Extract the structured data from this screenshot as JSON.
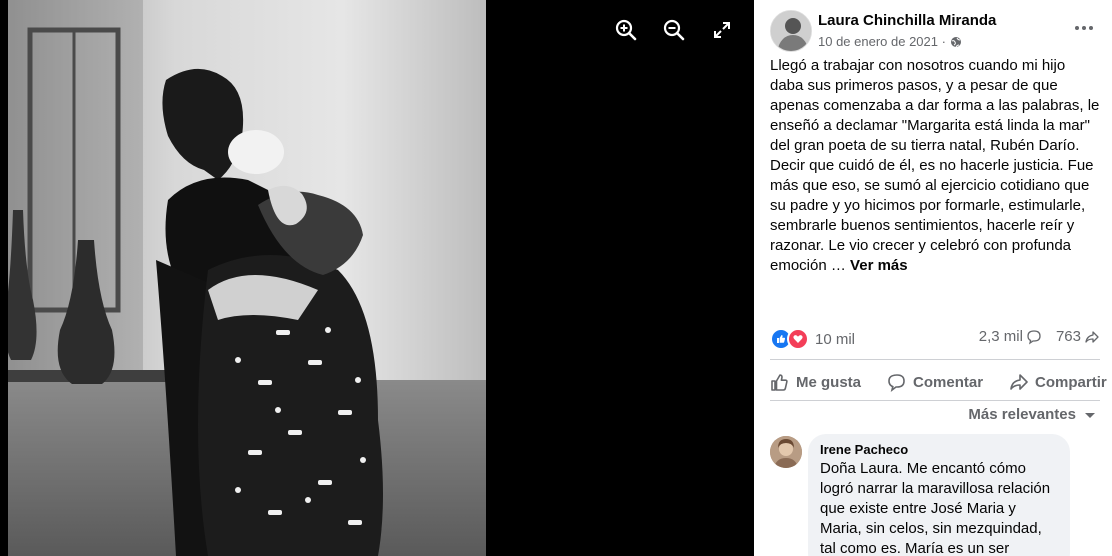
{
  "viewer": {
    "photo_alt": "Black and white photo of a young man in a face mask hugging an older woman",
    "controls": [
      {
        "name": "zoom-in-icon",
        "label": "Zoom in"
      },
      {
        "name": "zoom-out-icon",
        "label": "Zoom out"
      },
      {
        "name": "fullscreen-icon",
        "label": "Full screen"
      }
    ]
  },
  "post": {
    "author": "Laura Chinchilla Miranda",
    "date": "10 de enero de 2021 ·",
    "privacy_icon": "globe-icon",
    "text": "Llegó a trabajar con nosotros cuando mi hijo daba sus primeros pasos, y a pesar de que apenas comenzaba a dar forma a las palabras, le enseñó a declamar \"Margarita está linda la mar\" del gran poeta de su tierra natal, Rubén Darío. Decir que cuidó de él, es no hacerle justicia. Fue más que eso, se sumó al ejercicio cotidiano que su padre y yo hicimos por formarle, estimularle, sembrarle buenos sentimientos, hacerle reír y razonar. Le vio crecer y celebró con profunda emoción …",
    "see_more": "Ver más"
  },
  "stats": {
    "reactions_count": "10 mil",
    "comments_count": "2,3 mil",
    "shares_count": "763"
  },
  "actions": {
    "like": "Me gusta",
    "comment": "Comentar",
    "share": "Compartir"
  },
  "comments": {
    "sort_label": "Más relevantes",
    "items": [
      {
        "author": "Irene Pacheco",
        "text": "Doña Laura. Me encantó cómo logró narrar la maravillosa relación que existe entre José Maria y Maria, sin celos, sin mezquindad, tal como es. María es un ser"
      }
    ]
  },
  "colors": {
    "accent": "#1877f2",
    "love": "#f33e58",
    "secondary_text": "#65676b",
    "bubble": "#f0f2f5"
  }
}
